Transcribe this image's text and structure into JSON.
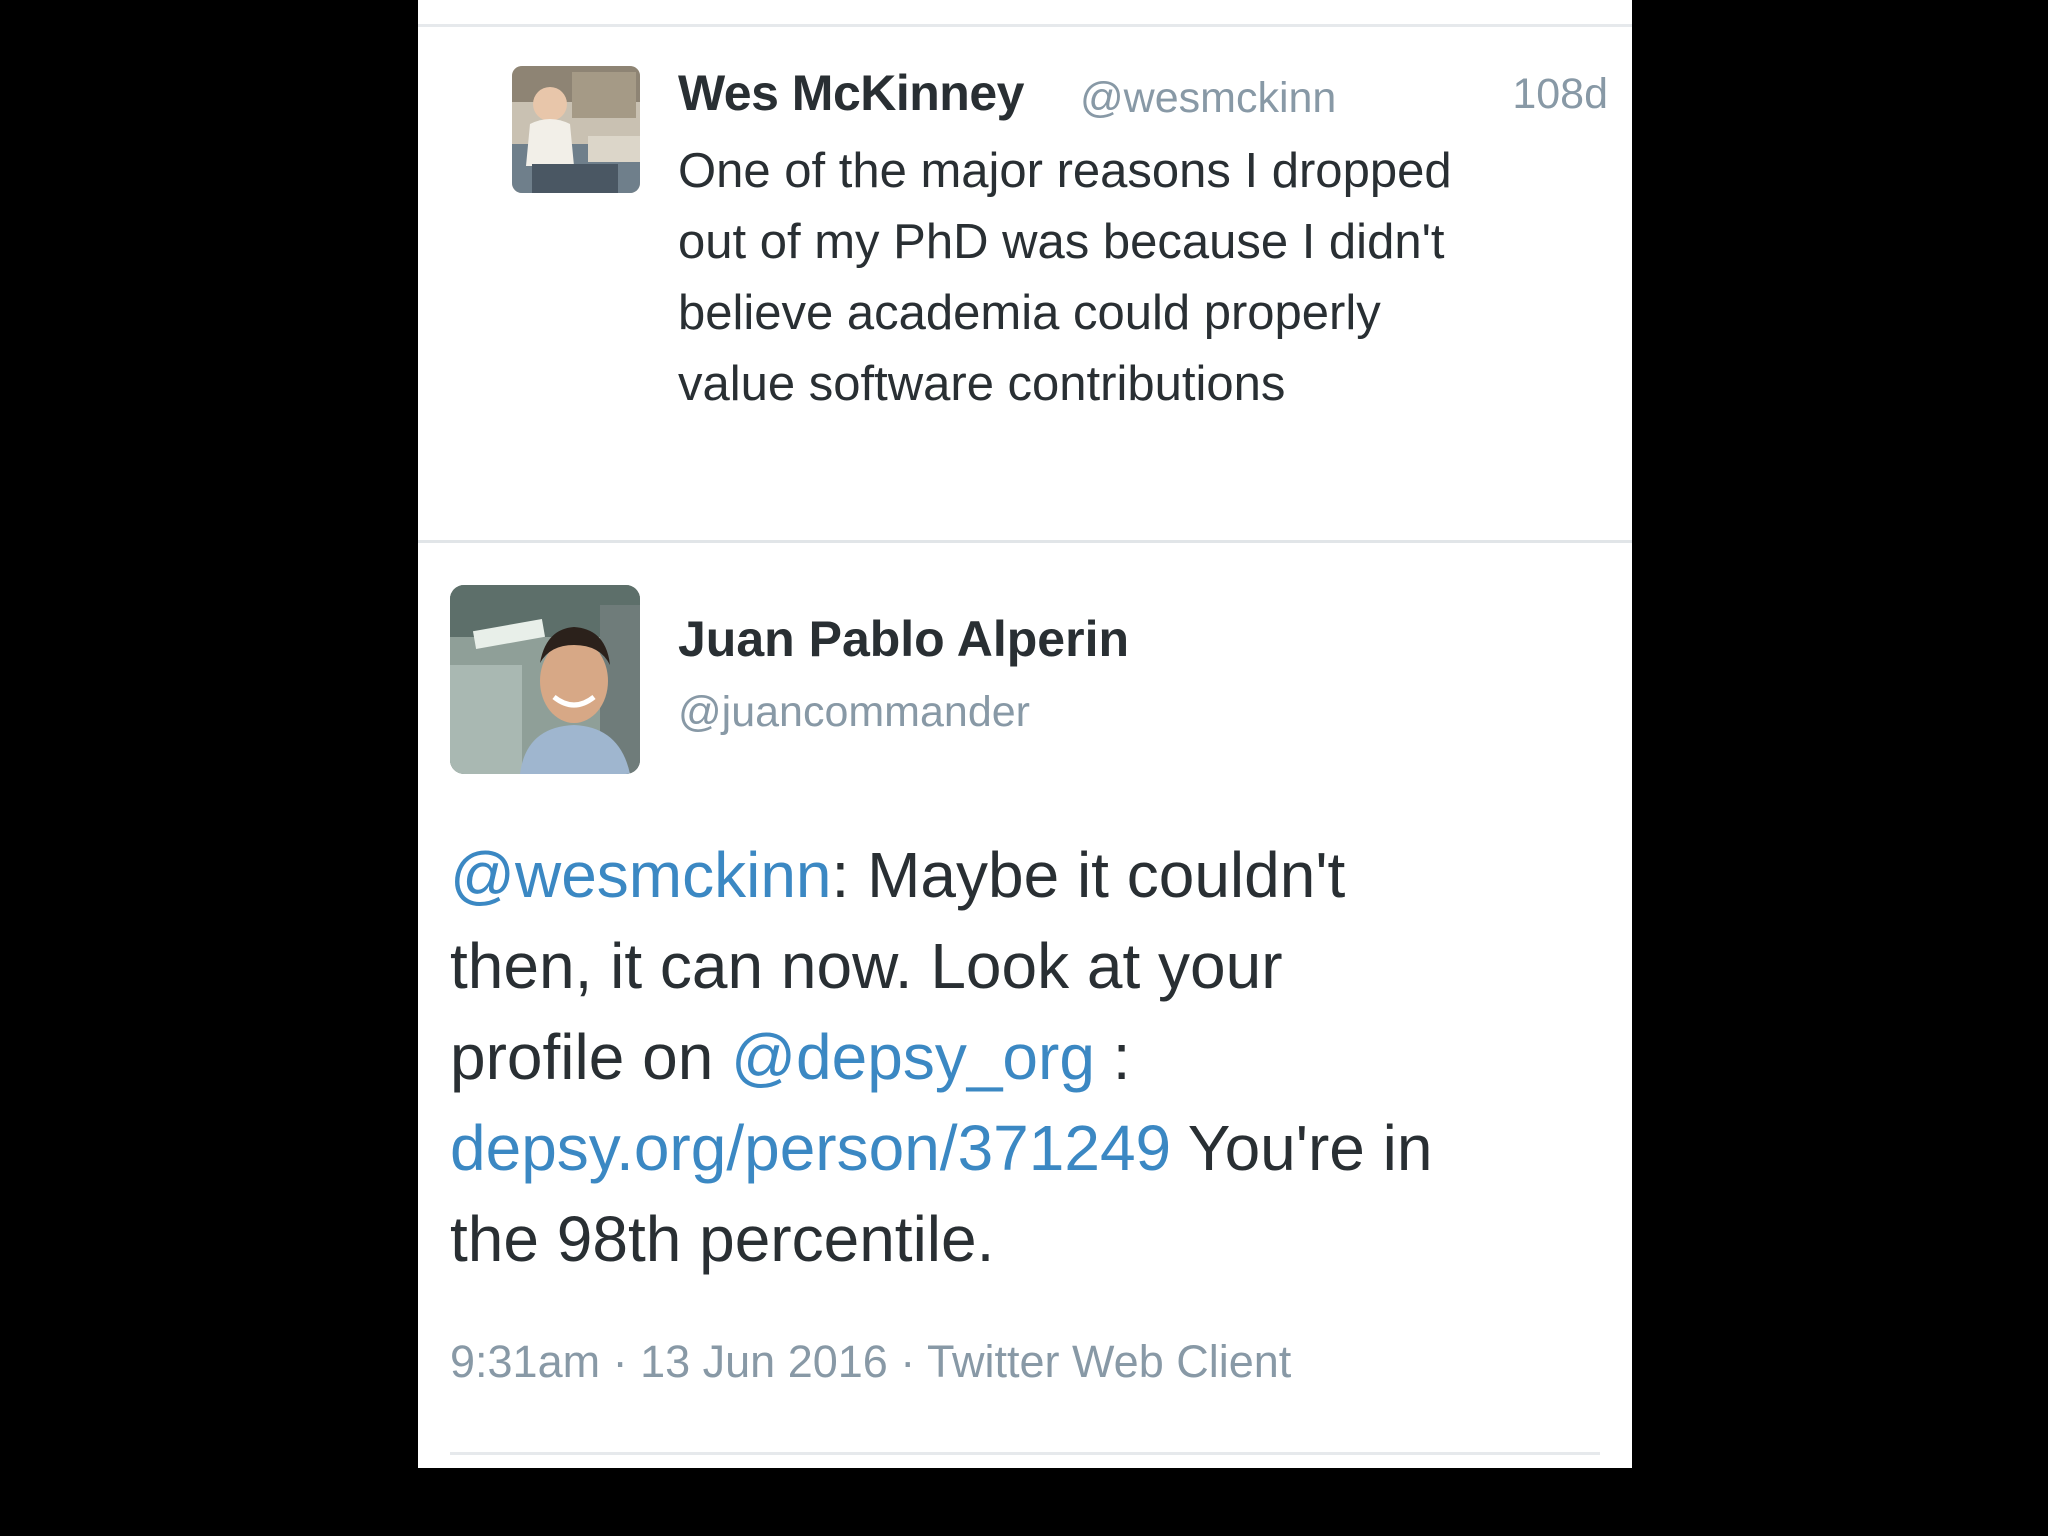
{
  "reply": {
    "name": "Wes McKinney",
    "handle": "@wesmckinn",
    "time": "108d",
    "text_lines": [
      "One of the major reasons I dropped",
      "out of my PhD was because I didn't",
      "believe academia could properly",
      "value software contributions"
    ]
  },
  "tweet": {
    "name": "Juan Pablo Alperin",
    "handle": "@juancommander",
    "mention_1": "@wesmckinn",
    "text_1": ": Maybe it couldn't",
    "line_2": "then, it can now. Look at your",
    "text_3a": "profile on ",
    "mention_2": "@depsy_org",
    "text_3b": " :",
    "link": "depsy.org/person/371249",
    "text_4": " You're in",
    "line_5": "the 98th percentile.",
    "meta": "9:31am · 13 Jun 2016 · Twitter Web Client"
  },
  "colors": {
    "background": "#000000",
    "panel": "#ffffff",
    "text": "#292f33",
    "secondary": "#8899a6",
    "link": "#3b88c3"
  },
  "icons": [
    "avatar-wes",
    "avatar-juan"
  ]
}
